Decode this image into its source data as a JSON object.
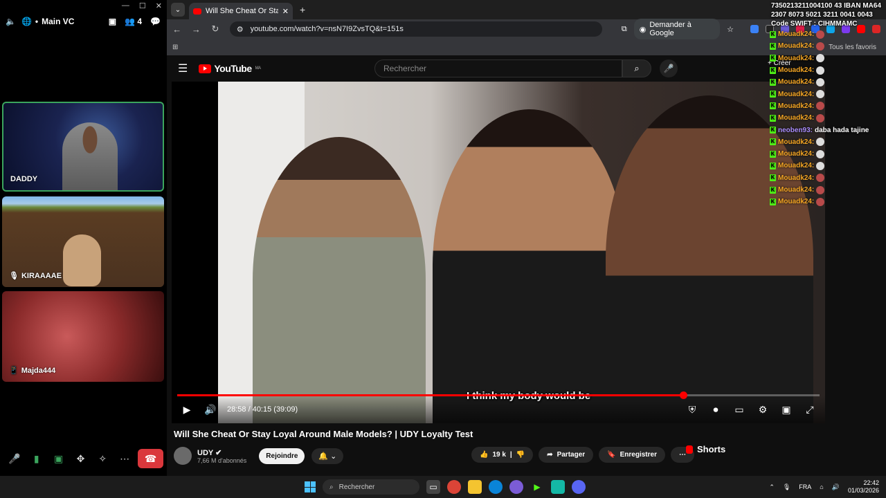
{
  "discord": {
    "channel": "Main VC",
    "member_count": "4",
    "participants": [
      {
        "name": "DADDY"
      },
      {
        "name": "KIRAAAAE"
      },
      {
        "name": "Majda444"
      }
    ]
  },
  "browser": {
    "tab_title": "Will She Cheat Or Stay Loyal Ar",
    "url": "youtube.com/watch?v=nsN7I9ZvsTQ&t=151s",
    "ask_google": "Demander à Google",
    "all_bookmarks": "Tous les favoris"
  },
  "youtube": {
    "logo_text": "YouTube",
    "region": "MA",
    "search_placeholder": "Rechercher",
    "create_label": "Créer",
    "subtitle_text": "I think my body would be",
    "progress_fraction": 0.7876,
    "time_display": "28:58 / 40:15 (39:09)",
    "video_title": "Will She Cheat Or Stay Loyal Around Male Models? | UDY Loyalty Test",
    "channel_name": "UDY",
    "subscribers": "7,66 M d'abonnés",
    "join_label": "Rejoindre",
    "likes": "19 k",
    "share_label": "Partager",
    "save_label": "Enregistrer",
    "shorts_label": "Shorts"
  },
  "chat": {
    "pinned": "7350213211004100 43 IBAN MA64 2307 8073 5021 3211 0041 0043 Code SWIFT : CIHMMAMC",
    "messages": [
      {
        "user": "Mouadk24:",
        "color": "#f5a623",
        "emote": "red"
      },
      {
        "user": "Mouadk24:",
        "color": "#f5a623",
        "emote": "red"
      },
      {
        "user": "Mouadk24:",
        "color": "#f5a623",
        "emote": "light"
      },
      {
        "user": "Mouadk24:",
        "color": "#f5a623",
        "emote": "light"
      },
      {
        "user": "Mouadk24:",
        "color": "#f5a623",
        "emote": "light"
      },
      {
        "user": "Mouadk24:",
        "color": "#f5a623",
        "emote": "light"
      },
      {
        "user": "Mouadk24:",
        "color": "#f5a623",
        "emote": "red"
      },
      {
        "user": "Mouadk24:",
        "color": "#f5a623",
        "emote": "red"
      },
      {
        "user": "neoben93:",
        "color": "#a78bfa",
        "text": "daba hada tajine"
      },
      {
        "user": "Mouadk24:",
        "color": "#f5a623",
        "emote": "light"
      },
      {
        "user": "Mouadk24:",
        "color": "#f5a623",
        "emote": "light"
      },
      {
        "user": "Mouadk24:",
        "color": "#f5a623",
        "emote": "light"
      },
      {
        "user": "Mouadk24:",
        "color": "#f5a623",
        "emote": "red"
      },
      {
        "user": "Mouadk24:",
        "color": "#f5a623",
        "emote": "red"
      },
      {
        "user": "Mouadk24:",
        "color": "#f5a623",
        "emote": "red"
      }
    ]
  },
  "taskbar": {
    "search_placeholder": "Rechercher",
    "language": "FRA",
    "time": "22:42",
    "date": "01/03/2026"
  },
  "colors": {
    "accent_red": "#ff0000",
    "discord_green": "#3ba55d",
    "kick_green": "#53fc18"
  }
}
